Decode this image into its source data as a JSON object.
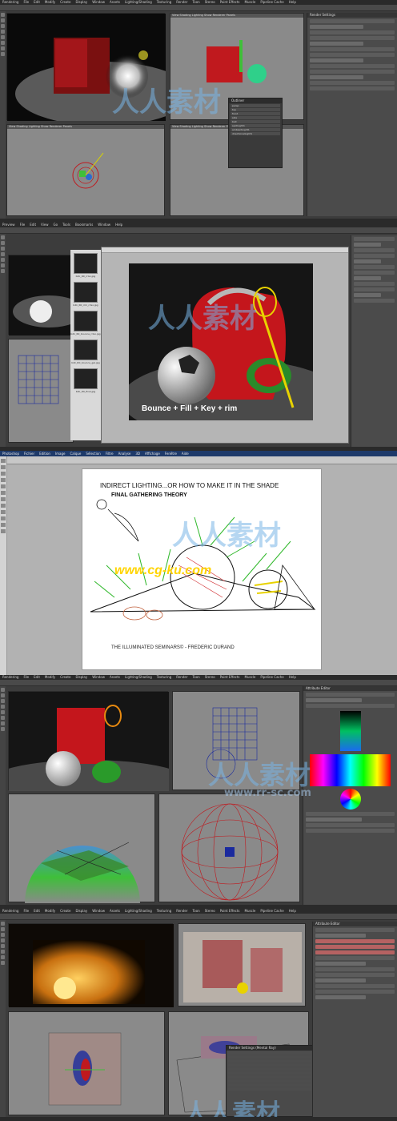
{
  "menu": {
    "maya": [
      "Rendering",
      "File",
      "Edit",
      "Modify",
      "Create",
      "Display",
      "Window",
      "Assets",
      "Lighting/Shading",
      "Texturing",
      "Render",
      "Toon",
      "Stereo",
      "Paint Effects",
      "Muscle",
      "Pipeline Cache",
      "Help"
    ],
    "preview": [
      "Preview",
      "File",
      "Edit",
      "View",
      "Go",
      "Tools",
      "Bookmarks",
      "Window",
      "Help"
    ],
    "photoshop": [
      "Photoshop",
      "Fichier",
      "Edition",
      "Image",
      "Calque",
      "Sélection",
      "Filtre",
      "Analyse",
      "3D",
      "Affichage",
      "Fenêtre",
      "Aide"
    ]
  },
  "panel1": {
    "attr_title": "Render Settings",
    "outliner_title": "Outliner",
    "outliner_items": [
      "persp",
      "top",
      "front",
      "side",
      "ball",
      "spotLight1",
      "ambientLight1",
      "directionalLight1"
    ]
  },
  "panel2": {
    "preview_caption": "Bounce + Fill + Key + rim",
    "thumb_labels": [
      "b2k_R0_rrGo.jpg",
      "b2k_R0_rim_rrGo.jpg",
      "b2k_R0_bounce_rrGo.jpg",
      "b2k_R0_bounce_gel.jpg",
      "b2k_R0_final.jpg"
    ]
  },
  "panel3": {
    "line1": "INDIRECT LIGHTING...OR HOW TO MAKE IT IN THE SHADE",
    "line2": "FINAL GATHERING  THEORY",
    "footer": "THE ILLUMINATED SEMINARS© - FREDERIC DURAND",
    "watermark": "www.cg-ku.com"
  },
  "panel4": {
    "attr_title": "Attribute Editor",
    "watermark": "www.rr-sc.com"
  },
  "panel5": {
    "attr_title": "Attribute Editor",
    "dialog_title": "Render Settings (Mental Ray)"
  },
  "watermark_cn": "人人素材",
  "colors": {
    "maya_bg": "#3c3c3c",
    "red_bag": "#c0191e",
    "ball": "#f2f2f2",
    "green": "#3fbf3a",
    "blue_wire": "#1a2a9e",
    "yellow": "#f2d000"
  }
}
